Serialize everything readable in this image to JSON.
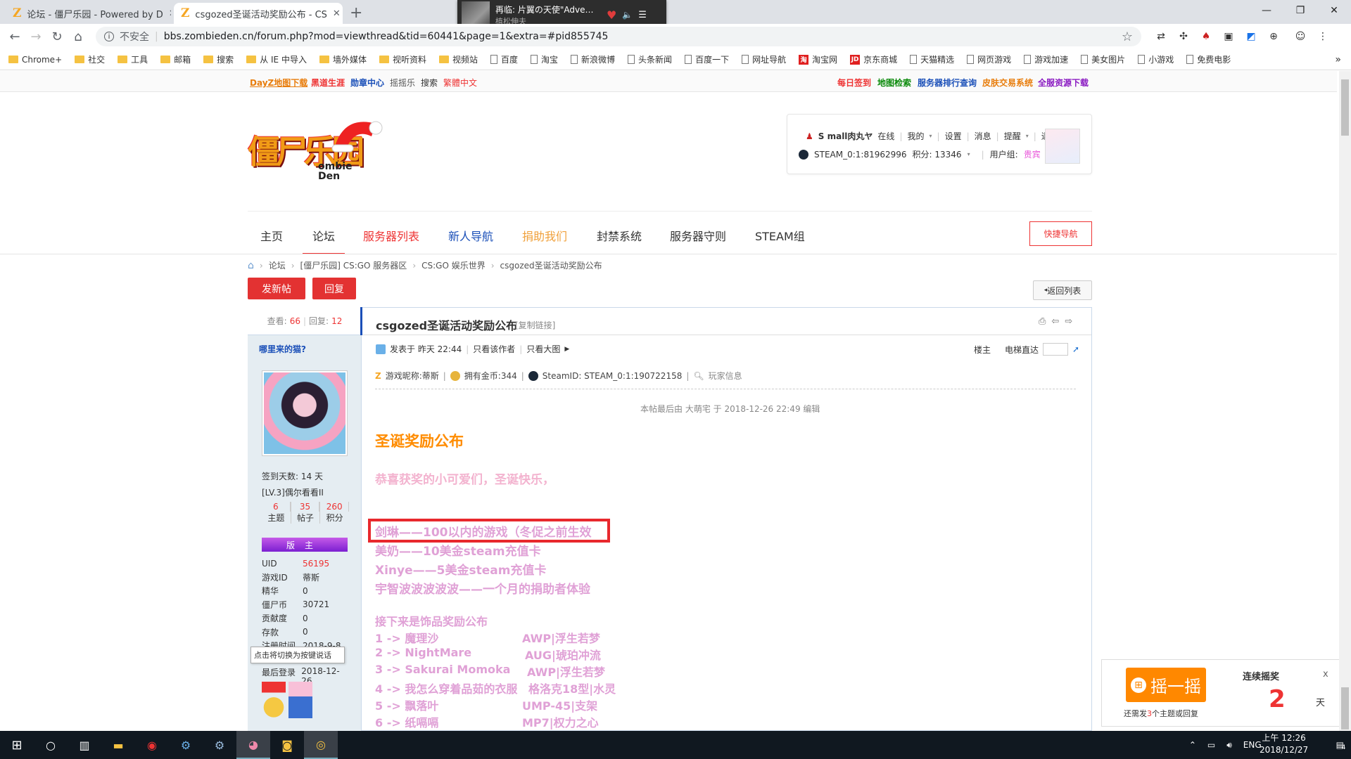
{
  "browser": {
    "tabs": [
      {
        "title": "论坛 - 僵尸乐园 - Powered by D",
        "active": false
      },
      {
        "title": "csgozed圣诞活动奖励公布 - CS",
        "active": true
      }
    ],
    "new_tab": "+",
    "media": {
      "title": "再临: 片翼の天使\"Adve…",
      "artist": "植松伸夫"
    },
    "security": "不安全",
    "url": "bbs.zombieden.cn/forum.php?mod=viewthread&tid=60441&page=1&extra=#pid855745",
    "bookmarks": [
      {
        "label": "Chrome+",
        "kind": "folder"
      },
      {
        "label": "社交",
        "kind": "folder"
      },
      {
        "label": "工具",
        "kind": "folder"
      },
      {
        "label": "邮箱",
        "kind": "folder"
      },
      {
        "label": "搜索",
        "kind": "folder"
      },
      {
        "label": "从 IE 中导入",
        "kind": "folder"
      },
      {
        "label": "墙外媒体",
        "kind": "folder"
      },
      {
        "label": "视听资料",
        "kind": "folder"
      },
      {
        "label": "视频站",
        "kind": "folder"
      },
      {
        "label": "百度",
        "kind": "page"
      },
      {
        "label": "淘宝",
        "kind": "page"
      },
      {
        "label": "新浪微博",
        "kind": "page"
      },
      {
        "label": "头条新闻",
        "kind": "page"
      },
      {
        "label": "百度一下",
        "kind": "page"
      },
      {
        "label": "网址导航",
        "kind": "page"
      },
      {
        "label": "淘宝网",
        "kind": "red"
      },
      {
        "label": "京东商城",
        "kind": "red"
      },
      {
        "label": "天猫精选",
        "kind": "page"
      },
      {
        "label": "网页游戏",
        "kind": "page"
      },
      {
        "label": "游戏加速",
        "kind": "page"
      },
      {
        "label": "美女图片",
        "kind": "page"
      },
      {
        "label": "小游戏",
        "kind": "page"
      },
      {
        "label": "免费电影",
        "kind": "page"
      }
    ],
    "bookmarks_more": "»"
  },
  "site": {
    "toplinks_left": [
      "DayZ地图下载",
      "黑道生涯",
      "勋章中心",
      "摇摇乐",
      "搜索",
      "繁體中文"
    ],
    "toplinks_right": [
      "每日签到",
      "地图检索",
      "服务器排行查询",
      "皮肤交易系统",
      "全服资源下载"
    ],
    "logo_main": "僵尸乐园",
    "logo_sub": "ombie Den",
    "user": {
      "name": "S mall肉丸ヤ",
      "status": "在线",
      "links": [
        "我的",
        "设置",
        "消息",
        "提醒",
        "退出"
      ],
      "steam": "STEAM_0:1:81962996",
      "points": "积分: 13346",
      "group_label": "用户组:",
      "group": "贵宾"
    },
    "nav": [
      "主页",
      "论坛",
      "服务器列表",
      "新人导航",
      "捐助我们",
      "封禁系统",
      "服务器守则",
      "STEAM组"
    ],
    "quick_nav": "快捷导航",
    "breadcrumb": [
      "论坛",
      "[僵尸乐园] CS:GO 服务器区",
      "CS:GO 娱乐世界",
      "csgozed圣诞活动奖励公布"
    ],
    "btn_new": "发新帖",
    "btn_reply": "回复",
    "back_list": "返回列表"
  },
  "post": {
    "views_label": "查看:",
    "views": "66",
    "replies_label": "回复:",
    "replies": "12",
    "title": "csgozed圣诞活动奖励公布",
    "copy_link": "[复制链接]",
    "author": "哪里来的猫?",
    "posted": "发表于 昨天 22:44",
    "only_author": "只看该作者",
    "large_img": "只看大图",
    "floor": "楼主",
    "elevator": "电梯直达",
    "gameinfo": {
      "nick": "游戏昵称:蒂斯",
      "gold": "拥有金币:344",
      "steamid": "SteamID: STEAM_0:1:190722158",
      "player": "玩家信息"
    },
    "edited": "本帖最后由 大萌宅 于 2018-12-26 22:49 编辑",
    "heading": "圣诞奖励公布",
    "greeting": "恭喜获奖的小可爱们，圣诞快乐，",
    "awards": [
      "剑琳——100以内的游戏（冬促之前生效",
      "美奶——10美金steam充值卡",
      "Xinye——5美金steam充值卡",
      "宇智波波波波波——一个月的捐助者体验"
    ],
    "skins_heading": "接下来是饰品奖励公布",
    "skins": [
      {
        "who": "1 -> 魔理沙",
        "item": "AWP|浮生若梦"
      },
      {
        "who": "2 -> NightMare",
        "item": "AUG|琥珀冲流"
      },
      {
        "who": "3 -> Sakurai Momoka",
        "item": "AWP|浮生若梦"
      },
      {
        "who": "4 -> 我怎么穿着品茹的衣服",
        "item": "格洛克18型|水灵"
      },
      {
        "who": "5 -> 飘落叶",
        "item": "UMP-45|支架"
      },
      {
        "who": "6 -> 纸嗝嗝",
        "item": "MP7|权力之心"
      }
    ]
  },
  "profile": {
    "sign_days": "签到天数: 14 天",
    "level": "[LV.3]偶尔看看II",
    "stats": [
      {
        "value": "6",
        "label": "主题"
      },
      {
        "value": "35",
        "label": "帖子"
      },
      {
        "value": "260",
        "label": "积分"
      }
    ],
    "badge": "版主",
    "rows": [
      {
        "k": "UID",
        "v": "56195"
      },
      {
        "k": "游戏ID",
        "v": "蒂斯"
      },
      {
        "k": "精华",
        "v": "0"
      },
      {
        "k": "僵尸币",
        "v": "30721"
      },
      {
        "k": "贡献度",
        "v": "0"
      },
      {
        "k": "存款",
        "v": "0"
      },
      {
        "k": "注册时间",
        "v": "2018-9-8"
      }
    ],
    "last_login_label": "最后登录",
    "last_login": "2018-12-26",
    "tooltip": "点击将切换为按键说话"
  },
  "shake": {
    "button": "摇一摇",
    "streak_label": "连续摇奖",
    "streak": "2",
    "unit": "天",
    "hint_pre": "还需发",
    "hint_num": "3",
    "hint_post": "个主题或回复",
    "close": "x"
  },
  "taskbar": {
    "lang": "ENG",
    "time": "上午 12:26",
    "date": "2018/12/27",
    "notif": "4"
  }
}
